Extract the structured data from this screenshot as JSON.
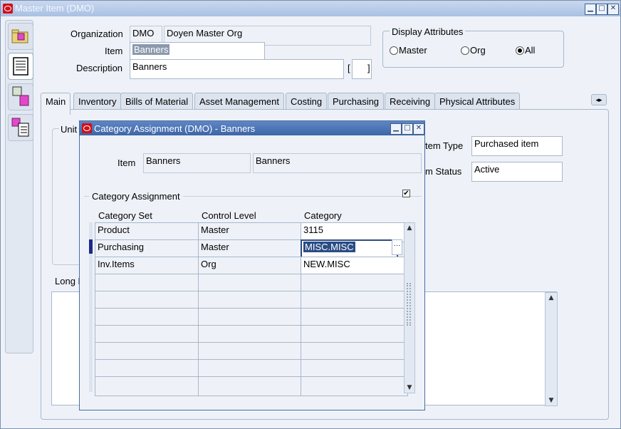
{
  "window": {
    "title": "Master Item (DMO)"
  },
  "header": {
    "organization_label": "Organization",
    "organization_code": "DMO",
    "organization_name": "Doyen Master Org",
    "item_label": "Item",
    "item_value": "Banners",
    "description_label": "Description",
    "description_value": "Banners",
    "bracket_open": "[",
    "bracket_close": "]"
  },
  "display_attributes": {
    "title": "Display Attributes",
    "options": [
      {
        "label": "Master",
        "selected": false
      },
      {
        "label": "Org",
        "selected": false
      },
      {
        "label": "All",
        "selected": true
      }
    ]
  },
  "tabs": [
    "Main",
    "Inventory",
    "Bills of Material",
    "Asset Management",
    "Costing",
    "Purchasing",
    "Receiving",
    "Physical Attributes"
  ],
  "main_panel": {
    "unit_label": "Unit",
    "item_type_label": "tem Type",
    "item_type_value": "Purchased item",
    "item_status_label": "m Status",
    "item_status_value": "Active",
    "long_desc_label": "Long D"
  },
  "dialog": {
    "title": "Category Assignment (DMO) - Banners",
    "item_label": "Item",
    "item_value1": "Banners",
    "item_value2": "Banners",
    "section_title": "Category Assignment",
    "columns": [
      "Category Set",
      "Control Level",
      "Category"
    ],
    "rows": [
      {
        "category_set": "Product",
        "control_level": "Master",
        "category": "3115"
      },
      {
        "category_set": "Purchasing",
        "control_level": "Master",
        "category": "MISC.MISC"
      },
      {
        "category_set": "Inv.Items",
        "control_level": "Org",
        "category": "NEW.MISC"
      },
      {
        "category_set": "",
        "control_level": "",
        "category": ""
      },
      {
        "category_set": "",
        "control_level": "",
        "category": ""
      },
      {
        "category_set": "",
        "control_level": "",
        "category": ""
      },
      {
        "category_set": "",
        "control_level": "",
        "category": ""
      },
      {
        "category_set": "",
        "control_level": "",
        "category": ""
      },
      {
        "category_set": "",
        "control_level": "",
        "category": ""
      },
      {
        "category_set": "",
        "control_level": "",
        "category": ""
      }
    ]
  },
  "colors": {
    "title_active": "#3d66a8",
    "title_inactive": "#a9c0e3",
    "selection": "#2b4c84"
  }
}
